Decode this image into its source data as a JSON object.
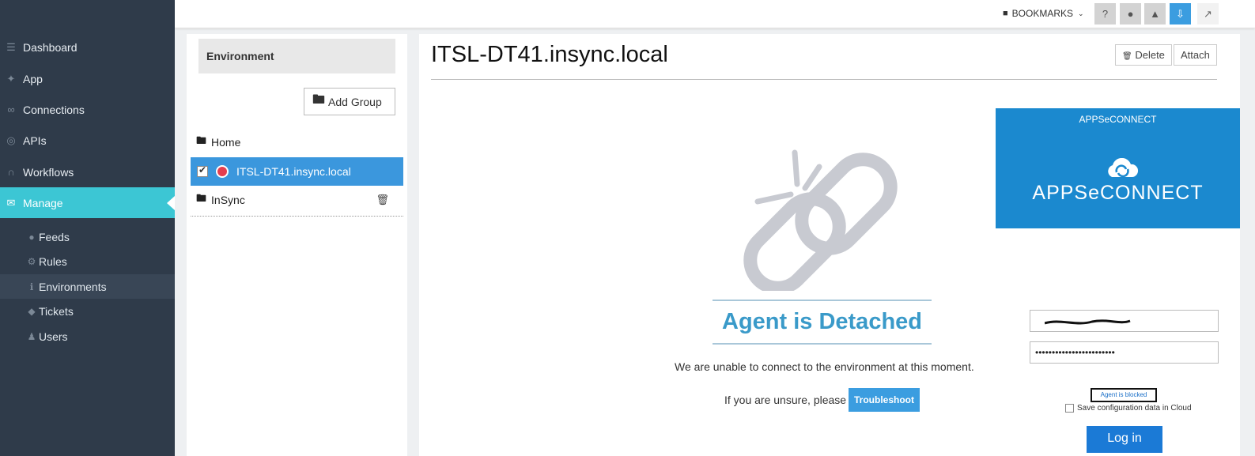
{
  "sidebar": {
    "items": [
      {
        "label": "Dashboard",
        "icon": "database-icon"
      },
      {
        "label": "App",
        "icon": "plug-icon"
      },
      {
        "label": "Connections",
        "icon": "link-icon"
      },
      {
        "label": "APIs",
        "icon": "globe-icon"
      },
      {
        "label": "Workflows",
        "icon": "workflow-icon"
      },
      {
        "label": "Manage",
        "icon": "chat-icon"
      }
    ],
    "subitems": [
      {
        "label": "Feeds",
        "icon": "comments-icon"
      },
      {
        "label": "Rules",
        "icon": "gear-icon"
      },
      {
        "label": "Environments",
        "icon": "info-icon"
      },
      {
        "label": "Tickets",
        "icon": "ticket-icon"
      },
      {
        "label": "Users",
        "icon": "user-icon"
      }
    ]
  },
  "topbar": {
    "bookmarks_label": "BOOKMARKS"
  },
  "environment_panel": {
    "header": "Environment",
    "add_group_label": "Add Group",
    "tree": [
      {
        "label": "Home"
      },
      {
        "label": "ITSL-DT41.insync.local"
      },
      {
        "label": "InSync"
      }
    ]
  },
  "main": {
    "title": "ITSL-DT41.insync.local",
    "delete_label": "Delete",
    "attach_label": "Attach",
    "status_title": "Agent is Detached",
    "message": "We are unable to connect to the environment at this moment.",
    "unsure_text": "If you are unsure, please",
    "troubleshoot_label": "Troubleshoot"
  },
  "overlay": {
    "small_title": "APPSeCONNECT",
    "logo_text": "APPSeCONNECT",
    "password_mask": "••••••••••••••••••••••••",
    "agent_blocked": "Agent is blocked",
    "save_label": "Save configuration data in Cloud",
    "login_label": "Log in"
  },
  "colors": {
    "sidebar_bg": "#2f3b4a",
    "active_nav": "#3cc6d4",
    "primary_blue": "#3b9de0",
    "detached_text": "#3a9ac9",
    "brand_blue": "#1b89cf"
  }
}
